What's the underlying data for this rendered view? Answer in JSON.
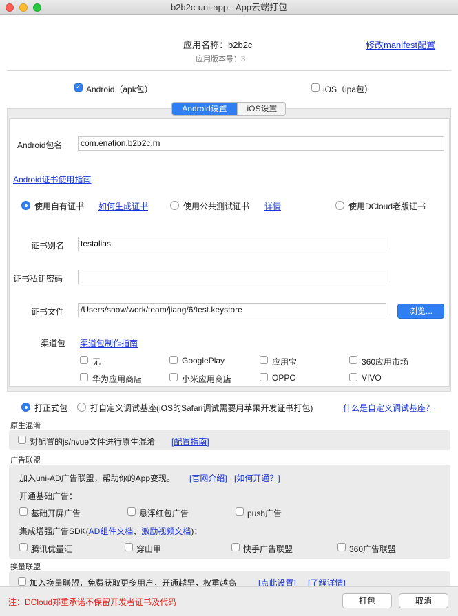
{
  "window": {
    "title": "b2b2c-uni-app - App云端打包"
  },
  "header": {
    "app_name_label": "应用名称：b2b2c",
    "version_label": "应用版本号：3",
    "manifest_link": "修改manifest配置"
  },
  "platforms": {
    "android_label": "Android（apk包）",
    "android_checked": true,
    "ios_label": "iOS（ipa包）",
    "ios_checked": false
  },
  "tabs": [
    {
      "label": "Android设置",
      "active": true
    },
    {
      "label": "iOS设置",
      "active": false
    }
  ],
  "android": {
    "package_label": "Android包名",
    "package_value": "com.enation.b2b2c.rn",
    "cert_guide_link": "Android证书使用指南",
    "cert_options": {
      "own": "使用自有证书",
      "how_to_generate": "如何生成证书",
      "public_test": "使用公共测试证书",
      "details": "详情",
      "dcloud_old": "使用DCloud老版证书",
      "selected": "own"
    },
    "alias_label": "证书别名",
    "alias_value": "testalias",
    "password_label": "证书私钥密码",
    "password_value": "",
    "file_label": "证书文件",
    "file_value": "/Users/snow/work/team/jiang/6/test.keystore",
    "browse_button": "浏览...",
    "channel_label": "渠道包",
    "channel_guide_link": "渠道包制作指南",
    "channels": [
      {
        "label": "无",
        "checked": false
      },
      {
        "label": "GooglePlay",
        "checked": false
      },
      {
        "label": "应用宝",
        "checked": false
      },
      {
        "label": "360应用市场",
        "checked": false
      },
      {
        "label": "华为应用商店",
        "checked": false
      },
      {
        "label": "小米应用商店",
        "checked": false
      },
      {
        "label": "OPPO",
        "checked": false
      },
      {
        "label": "VIVO",
        "checked": false
      }
    ]
  },
  "build_type": {
    "formal": "打正式包",
    "custom_debug": "打自定义调试基座(iOS的Safari调试需要用苹果开发证书打包)",
    "what_is_link": "什么是自定义调试基座？",
    "selected": "formal"
  },
  "obfuscation": {
    "section_title": "原生混淆",
    "option": "对配置的js/nvue文件进行原生混淆",
    "guide_link": "[配置指南]"
  },
  "ads": {
    "section_title": "广告联盟",
    "intro": "加入uni-AD广告联盟，帮助你的App变现。",
    "official_link": "[官网介绍]",
    "how_link": "[如何开通？]",
    "basic_label": "开通基础广告：",
    "basic_options": [
      "基础开屏广告",
      "悬浮红包广告",
      "push广告"
    ],
    "sdk_prefix": "集成增强广告SDK(",
    "sdk_doc_link": "AD组件文档",
    "sdk_sep": "、",
    "sdk_video_link": "激励视频文档",
    "sdk_suffix": ")：",
    "sdk_options": [
      "腾讯优量汇",
      "穿山甲",
      "快手广告联盟",
      "360广告联盟"
    ]
  },
  "exchange": {
    "section_title": "换量联盟",
    "option": "加入换量联盟，免费获取更多用户，开通越早，权重越高",
    "settings_link": "[点此设置]",
    "learn_link": "[了解详情]"
  },
  "footer": {
    "notice": "注：DCloud郑重承诺不保留开发者证书及代码",
    "pack_button": "打包",
    "cancel_button": "取消"
  },
  "colors": {
    "accent": "#2f7ff2",
    "link": "#1a35d6",
    "notice": "#e0201b"
  }
}
